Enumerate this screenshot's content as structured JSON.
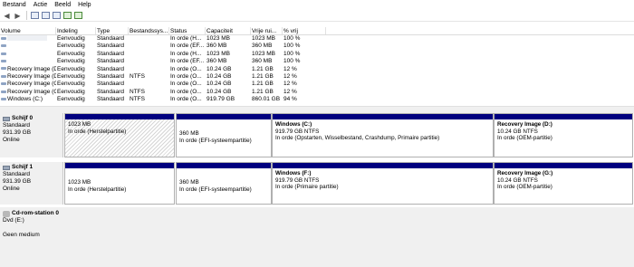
{
  "menu": [
    "Bestand",
    "Actie",
    "Beeld",
    "Help"
  ],
  "toolbar": {
    "back_icon": "arrow-left-icon",
    "forward_icon": "arrow-right-icon"
  },
  "volumes": {
    "columns": [
      "Volume",
      "Indeling",
      "Type",
      "Bestandssys...",
      "Status",
      "Capaciteit",
      "Vrije rui...",
      "% vrij"
    ],
    "rows": [
      {
        "name": "",
        "layout": "Eenvoudig",
        "type": "Standaard",
        "fs": "",
        "status": "In orde (H...",
        "capacity": "1023 MB",
        "free": "1023 MB",
        "pct": "100 %"
      },
      {
        "name": "",
        "layout": "Eenvoudig",
        "type": "Standaard",
        "fs": "",
        "status": "In orde (EF...",
        "capacity": "360 MB",
        "free": "360 MB",
        "pct": "100 %"
      },
      {
        "name": "",
        "layout": "Eenvoudig",
        "type": "Standaard",
        "fs": "",
        "status": "In orde (H...",
        "capacity": "1023 MB",
        "free": "1023 MB",
        "pct": "100 %"
      },
      {
        "name": "",
        "layout": "Eenvoudig",
        "type": "Standaard",
        "fs": "",
        "status": "In orde (EF...",
        "capacity": "360 MB",
        "free": "360 MB",
        "pct": "100 %"
      },
      {
        "name": "Recovery Image (D:)",
        "layout": "Eenvoudig",
        "type": "Standaard",
        "fs": "",
        "status": "In orde (O...",
        "capacity": "10.24 GB",
        "free": "1.21 GB",
        "pct": "12 %"
      },
      {
        "name": "Recovery Image (D:)",
        "layout": "Eenvoudig",
        "type": "Standaard",
        "fs": "NTFS",
        "status": "In orde (O...",
        "capacity": "10.24 GB",
        "free": "1.21 GB",
        "pct": "12 %"
      },
      {
        "name": "Recovery Image (G:)",
        "layout": "Eenvoudig",
        "type": "Standaard",
        "fs": "",
        "status": "In orde (O...",
        "capacity": "10.24 GB",
        "free": "1.21 GB",
        "pct": "12 %"
      },
      {
        "name": "Recovery Image (G:)",
        "layout": "Eenvoudig",
        "type": "Standaard",
        "fs": "NTFS",
        "status": "In orde (O...",
        "capacity": "10.24 GB",
        "free": "1.21 GB",
        "pct": "12 %"
      },
      {
        "name": "Windows (C:)",
        "layout": "Eenvoudig",
        "type": "Standaard",
        "fs": "NTFS",
        "status": "In orde (O...",
        "capacity": "919.79 GB",
        "free": "860.01 GB",
        "pct": "94 %"
      }
    ]
  },
  "disks": [
    {
      "title": "Schijf 0",
      "kind": "Standaard",
      "size": "931.39 GB",
      "state": "Online",
      "partitions": [
        {
          "name": "",
          "size": "1023 MB",
          "status": "In orde (Herstelpartitie)"
        },
        {
          "name": "",
          "size": "360 MB",
          "status": "In orde (EFI-systeempartitie)"
        },
        {
          "name": "Windows  (C:)",
          "size": "919.79 GB NTFS",
          "status": "In orde (Opstarten, Wisselbestand, Crashdump, Primaire partitie)"
        },
        {
          "name": "Recovery Image  (D:)",
          "size": "10.24 GB NTFS",
          "status": "In orde (OEM-partitie)"
        }
      ]
    },
    {
      "title": "Schijf 1",
      "kind": "Standaard",
      "size": "931.39 GB",
      "state": "Online",
      "partitions": [
        {
          "name": "",
          "size": "1023 MB",
          "status": "In orde (Herstelpartitie)"
        },
        {
          "name": "",
          "size": "360 MB",
          "status": "In orde (EFI-systeempartitie)"
        },
        {
          "name": "Windows  (F:)",
          "size": "919.79 GB NTFS",
          "status": "In orde (Primaire partitie)"
        },
        {
          "name": "Recovery Image  (G:)",
          "size": "10.24 GB NTFS",
          "status": "In orde (OEM-partitie)"
        }
      ]
    }
  ],
  "cdrom": {
    "title": "Cd-rom-station 0",
    "drive": "Dvd (E:)",
    "state": "Geen medium"
  }
}
